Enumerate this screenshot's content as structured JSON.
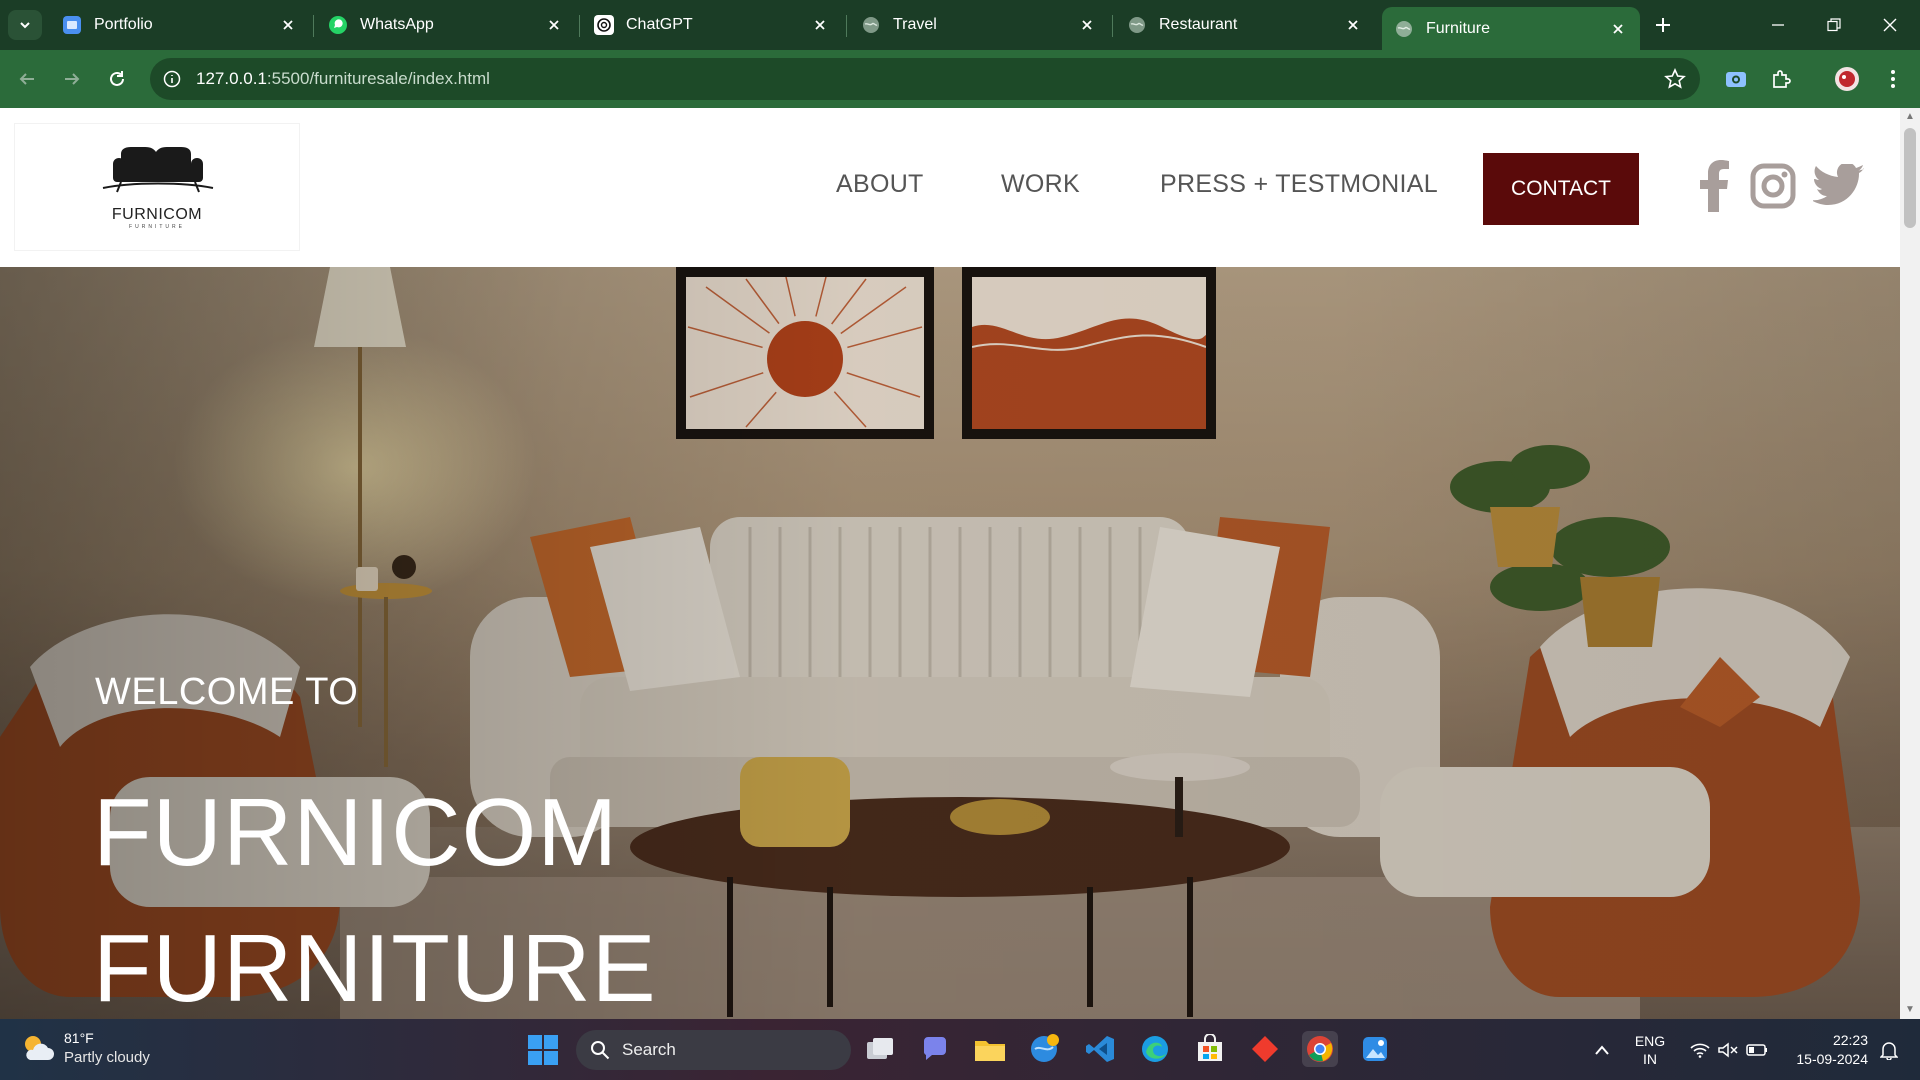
{
  "browser": {
    "tabs": [
      {
        "title": "Portfolio",
        "icon": "portfolio-favicon"
      },
      {
        "title": "WhatsApp",
        "icon": "whatsapp-favicon"
      },
      {
        "title": "ChatGPT",
        "icon": "chatgpt-favicon"
      },
      {
        "title": "Travel",
        "icon": "globe-favicon"
      },
      {
        "title": "Restaurant",
        "icon": "globe-favicon"
      },
      {
        "title": "Furniture",
        "icon": "globe-favicon",
        "active": true
      }
    ],
    "url_host": "127.0.0.1",
    "url_path": ":5500/furnituresale/index.html",
    "colors": {
      "tabbar": "#1b3d26",
      "toolbar": "#2b6b3a",
      "omnibox": "#1d4a28"
    }
  },
  "site": {
    "logo_brand": "FURNICOM",
    "logo_sub": "FURNITURE",
    "nav": [
      "ABOUT",
      "WORK",
      "PRESS + TESTMONIAL"
    ],
    "contact_label": "CONTACT",
    "contact_color": "#5a0a0a",
    "social_icons": [
      "facebook-icon",
      "instagram-icon",
      "twitter-icon"
    ],
    "social_color": "#a89e9b"
  },
  "hero": {
    "welcome": "WELCOME TO",
    "line1": "FURNICOM",
    "line2": "FURNITURE"
  },
  "taskbar": {
    "weather_temp": "81°F",
    "weather_desc": "Partly cloudy",
    "search_label": "Search",
    "lang_line1": "ENG",
    "lang_line2": "IN",
    "time": "22:23",
    "date": "15-09-2024"
  }
}
